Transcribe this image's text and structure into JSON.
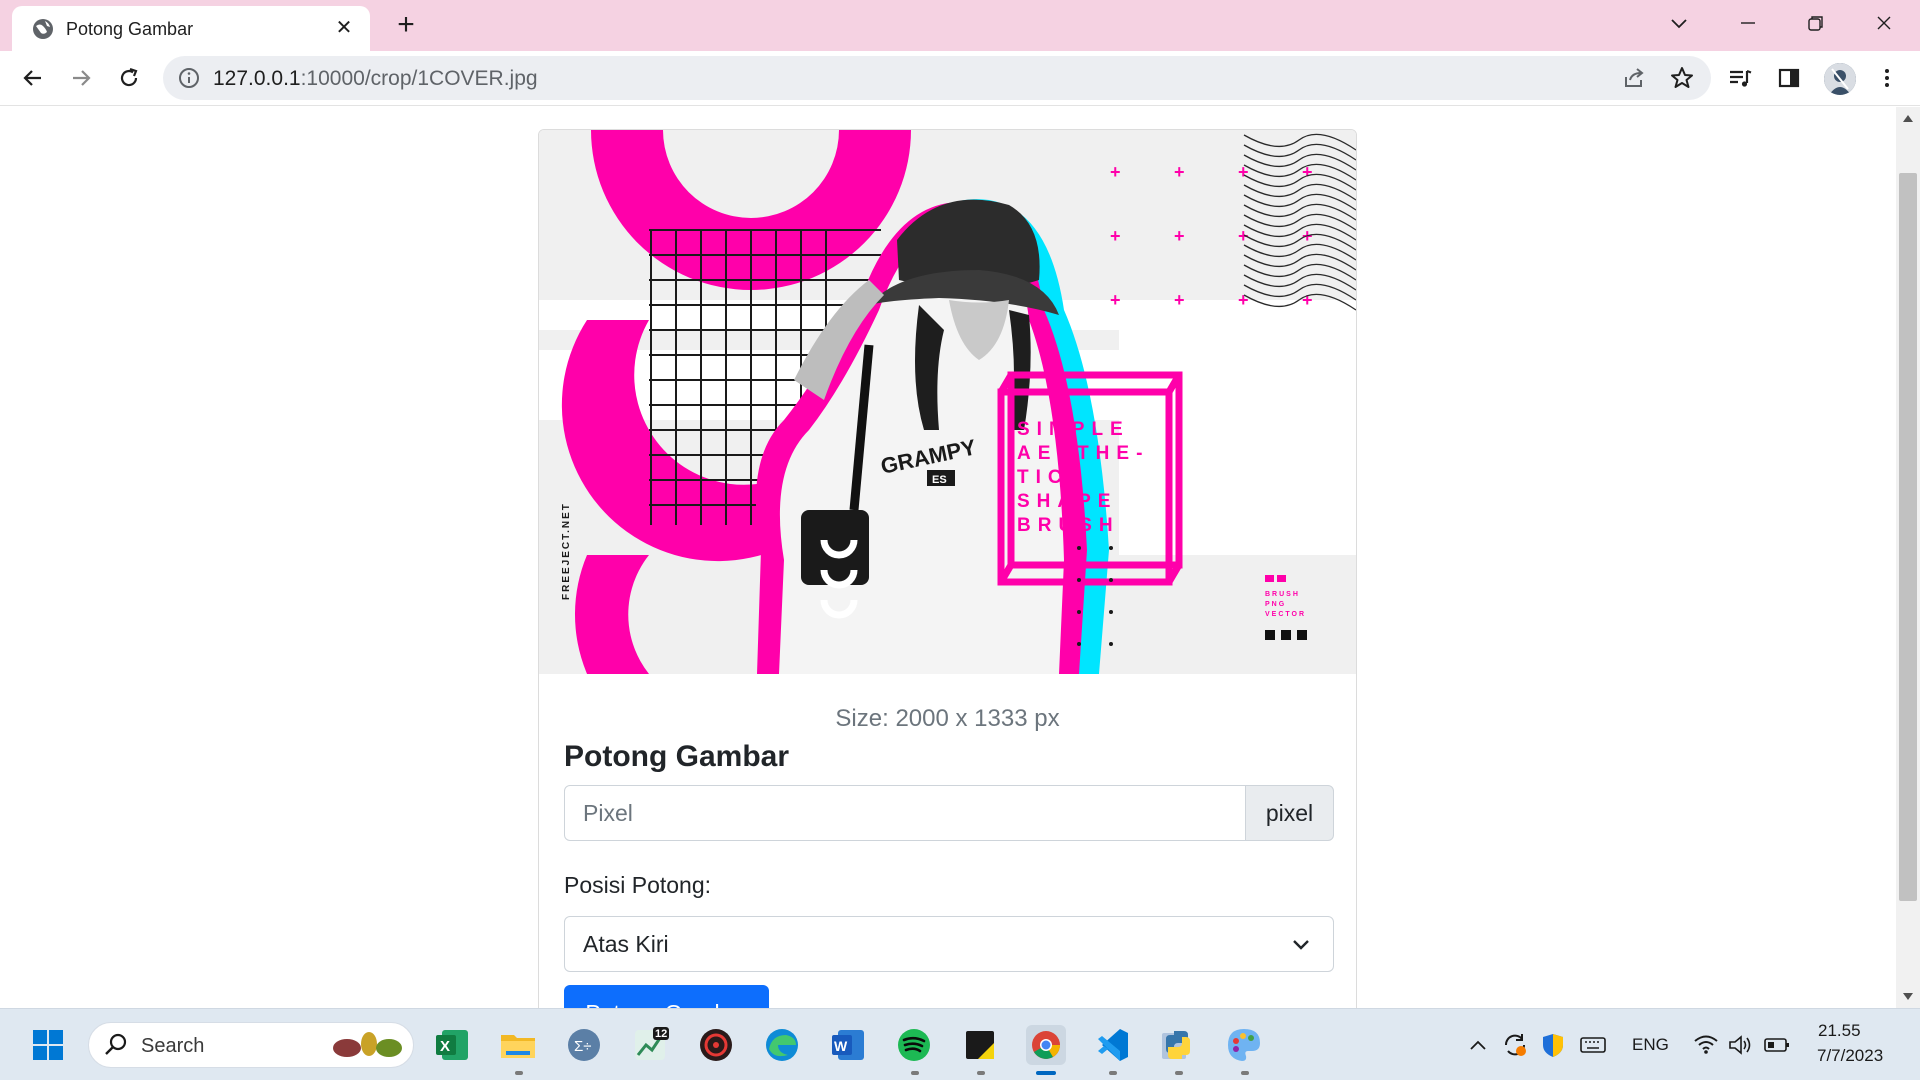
{
  "browser": {
    "tab_title": "Potong Gambar",
    "url_host": "127.0.0.1",
    "url_path": ":10000/crop/1COVER.jpg"
  },
  "preview_image": {
    "shirt_text": "GRAMPY",
    "shirt_badge": "ES",
    "brush_lines": [
      "SIMPLE",
      "AESTHE-",
      "TIC",
      "SHAPE",
      "BRUSH"
    ],
    "side_text": "FREEJECT.NET",
    "corner_lines": [
      "BRUSH",
      "PNG",
      "VECTOR"
    ],
    "accent_color": "#ff00aa",
    "cyan_color": "#00e5ff"
  },
  "form": {
    "size_text": "Size: 2000 x 1333 px",
    "heading": "Potong Gambar",
    "pixel_placeholder": "Pixel",
    "pixel_addon": "pixel",
    "position_label": "Posisi Potong:",
    "position_selected": "Atas Kiri",
    "submit_label": "Potong Gambar",
    "primary_color": "#0d6efd"
  },
  "taskbar": {
    "search_label": "Search",
    "lang": "ENG",
    "time": "21.55",
    "date": "7/7/2023",
    "badge_count": "12"
  }
}
